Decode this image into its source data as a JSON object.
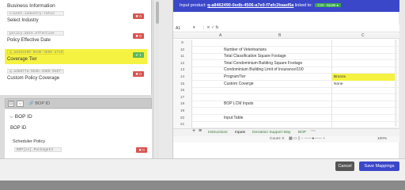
{
  "left": {
    "section_title": "Business Information",
    "fields": [
      {
        "code": "client.industry.ratio",
        "label": "Select Industry",
        "action": "✖ 0",
        "highlighted": false
      },
      {
        "code": "policy.date.effective",
        "label": "Policy Effective Date",
        "action": "✖ 0",
        "highlighted": false
      },
      {
        "code": "q.a8462490-0edb-4506-a7e0-f7afc2baad5a",
        "label": "Coverage Tier",
        "action": "✔ 1",
        "highlighted": true
      },
      {
        "code": "q.a4b8f7a-0edb-4386-9e87-f7afc2cd3d3c",
        "label": "Custom Policy Coverage",
        "action": "✖ 0",
        "highlighted": false
      }
    ],
    "bop_bar": {
      "checkbox": "☐",
      "chevron": "⌵",
      "link_icon": "🔗",
      "label": "BOP ID"
    },
    "bop_section": {
      "title": "BOP ID",
      "subtitle": "BOP ID",
      "sub_label": "Scheduler Policy",
      "code": "BOP[xx].PackageId",
      "action": "✖ 0"
    }
  },
  "right": {
    "banner": {
      "prefix": "Input product:",
      "product_id": "q-a8462490-0edb-4506-a7e0-f7afc2baad5a",
      "linked": "linked to:",
      "badge": "C34 - Inputs ●"
    },
    "formula_bar": {
      "cell_ref": "A1",
      "dropdown": "▾",
      "icons": "⋮  ✕  ✓  fx"
    },
    "columns": [
      "A",
      "B",
      "C"
    ],
    "rows": [
      {
        "num": "9",
        "b": "",
        "c": ""
      },
      {
        "num": "10",
        "b": "Number of Veterinarians",
        "c": ""
      },
      {
        "num": "11",
        "b": "Total Classification Square Footage",
        "c": ""
      },
      {
        "num": "12",
        "b": "Total Condominium Building Square Footage",
        "c": ""
      },
      {
        "num": "13",
        "b": "Condominium Building Limit of Insurance/100",
        "c": ""
      },
      {
        "num": "14",
        "b": "ProgramTier",
        "c": "Bronze",
        "hl": true
      },
      {
        "num": "15",
        "b": "Custom Coverge",
        "c": "None"
      },
      {
        "num": "16",
        "b": "",
        "c": ""
      },
      {
        "num": "17",
        "b": "",
        "c": ""
      },
      {
        "num": "18",
        "b": "BOP LCM Inputs",
        "c": ""
      },
      {
        "num": "19",
        "b": "",
        "c": ""
      },
      {
        "num": "20",
        "b": "Input Table",
        "c": ""
      },
      {
        "num": "21",
        "b": "",
        "c": ""
      }
    ],
    "sheet_tabs": [
      "Instructions",
      "Inputs",
      "Deviation Support May",
      "BOP"
    ],
    "active_tab": "Inputs",
    "tab_controls": {
      "add": "+",
      "menu": "≡",
      "overflow": "⋯"
    },
    "status": {
      "count": "Count: 0",
      "zoom": "100%",
      "zoom_controls": "▦  ▭  ▯  −  ——●——  +"
    }
  },
  "footer": {
    "cancel": "Cancel",
    "save": "Save Mappings"
  },
  "colors": {
    "accent": "#3b47c9",
    "highlight": "#f5f242",
    "danger": "#d9534f",
    "success": "#5cb85c"
  }
}
